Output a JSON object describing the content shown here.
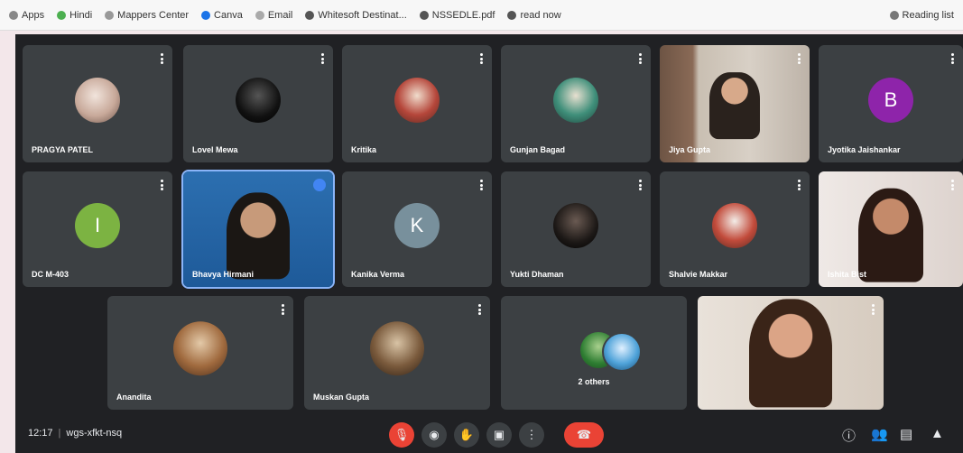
{
  "bookmarks": [
    {
      "label": "Apps",
      "icon": "apps-icon"
    },
    {
      "label": "Hindi",
      "icon": "bookmark-icon"
    },
    {
      "label": "Mappers Center",
      "icon": "bookmark-icon"
    },
    {
      "label": "Canva",
      "icon": "bookmark-icon"
    },
    {
      "label": "Email",
      "icon": "bookmark-icon"
    },
    {
      "label": "Whitesoft Destinat...",
      "icon": "bookmark-icon"
    },
    {
      "label": "NSSEDLE.pdf",
      "icon": "bookmark-icon"
    },
    {
      "label": "read now",
      "icon": "bookmark-icon"
    }
  ],
  "bookmarks_right": "Reading list",
  "participants": [
    {
      "name": "PRAGYA PATEL",
      "type": "photo"
    },
    {
      "name": "Lovel Mewa",
      "type": "photo"
    },
    {
      "name": "Kritika",
      "type": "photo"
    },
    {
      "name": "Gunjan Bagad",
      "type": "photo"
    },
    {
      "name": "Jiya Gupta",
      "type": "video"
    },
    {
      "name": "Jyotika Jaishankar",
      "type": "letter",
      "letter": "B",
      "color": "#8e24aa"
    },
    {
      "name": "DC M-403",
      "type": "letter",
      "letter": "I",
      "color": "#7cb342"
    },
    {
      "name": "Bhavya Hirmani",
      "type": "video",
      "active": true
    },
    {
      "name": "Kanika Verma",
      "type": "letter",
      "letter": "K",
      "color": "#78909c"
    },
    {
      "name": "Yukti Dhaman",
      "type": "photo"
    },
    {
      "name": "Shalvie Makkar",
      "type": "photo"
    },
    {
      "name": "Ishita Bist",
      "type": "video"
    },
    {
      "name": "Anandita",
      "type": "photo"
    },
    {
      "name": "Muskan Gupta",
      "type": "photo"
    },
    {
      "name": "2 others",
      "type": "group"
    },
    {
      "name": "",
      "type": "video"
    }
  ],
  "toolbar": {
    "time": "12:17",
    "meeting_code": "wgs-xfkt-nsq",
    "controls": [
      "mic-off-icon",
      "camera-icon",
      "hand-icon",
      "present-icon",
      "more-icon",
      "end-call-icon"
    ],
    "right_icons": [
      "info-icon",
      "people-icon",
      "chat-icon",
      "activities-icon"
    ]
  }
}
